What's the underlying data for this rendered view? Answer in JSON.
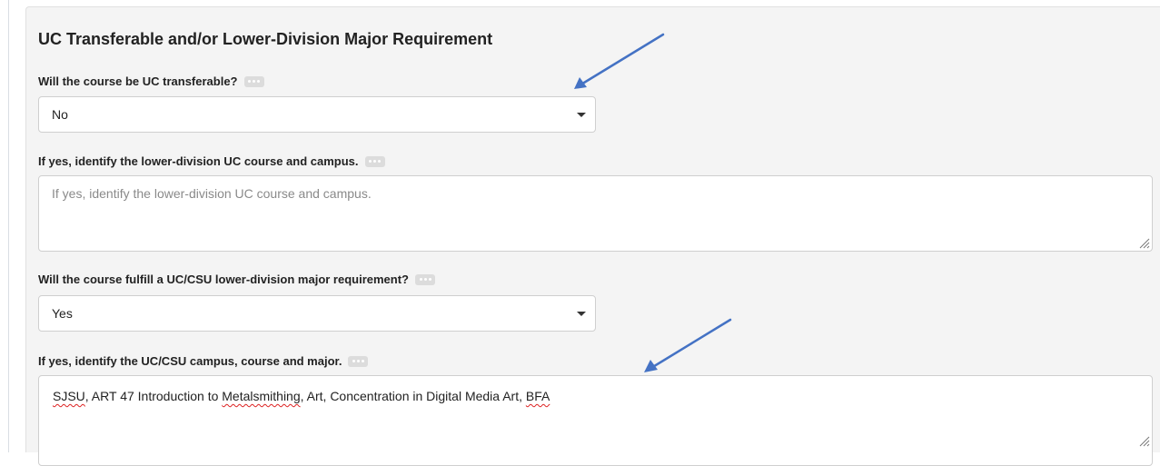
{
  "section": {
    "title": "UC Transferable and/or Lower-Division Major Requirement"
  },
  "fields": {
    "uc_transferable": {
      "label": "Will the course be UC transferable?",
      "value": "No",
      "icon": "more-dots-icon"
    },
    "uc_course_campus": {
      "label": "If yes, identify the lower-division UC course and campus.",
      "placeholder": "If yes, identify the lower-division UC course and campus.",
      "value": "",
      "icon": "more-dots-icon"
    },
    "major_requirement": {
      "label": "Will the course fulfill a UC/CSU lower-division major requirement?",
      "value": "Yes",
      "icon": "more-dots-icon"
    },
    "campus_course_major": {
      "label": "If yes, identify the UC/CSU campus, course and major.",
      "value_parts": [
        "SJSU",
        ", ART 47 Introduction to ",
        "Metalsmithing",
        ", Art, Concentration in Digital Media Art, ",
        "BFA"
      ],
      "icon": "more-dots-icon"
    }
  },
  "colors": {
    "panel_background": "#f4f4f4",
    "annotation_arrow": "#4472c4",
    "spellcheck_underline": "#dd2222"
  }
}
